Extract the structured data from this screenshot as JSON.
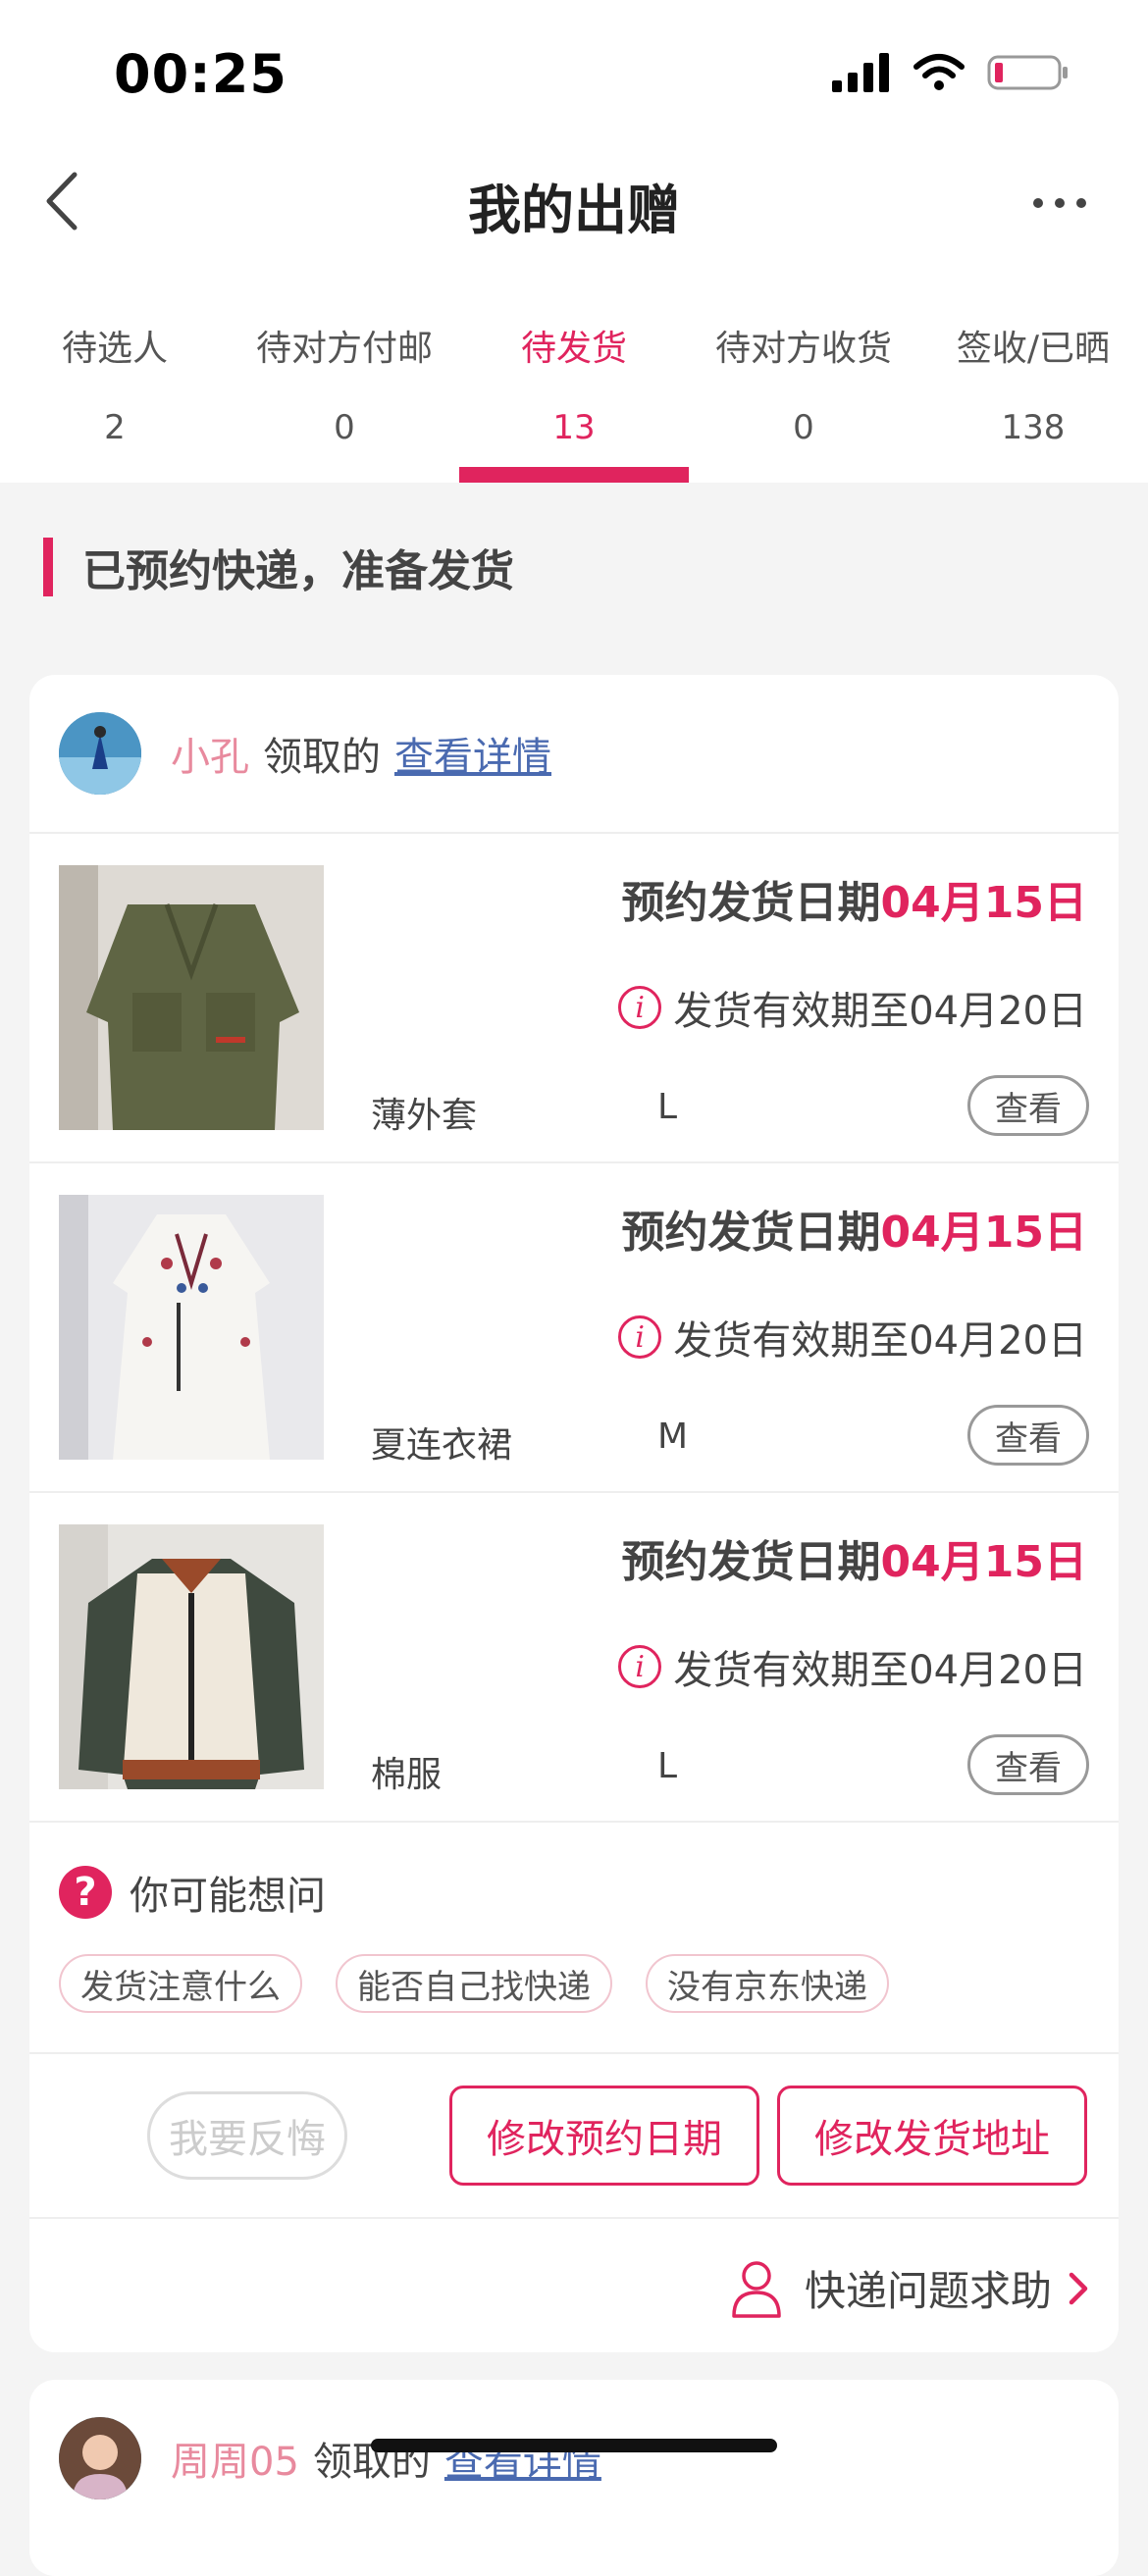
{
  "status_bar": {
    "time": "00:25"
  },
  "nav": {
    "title": "我的出赠",
    "back_icon": "chevron-left-icon",
    "more_icon": "more-icon"
  },
  "tabs": [
    {
      "label": "待选人",
      "count": "2"
    },
    {
      "label": "待对方付邮",
      "count": "0"
    },
    {
      "label": "待发货",
      "count": "13",
      "active": true
    },
    {
      "label": "待对方收货",
      "count": "0"
    },
    {
      "label": "签收/已晒",
      "count": "138"
    }
  ],
  "section": {
    "title": "已预约快递，准备发货"
  },
  "cards": [
    {
      "recipient": "小孔",
      "claimed_text": "领取的",
      "detail_link": "查看详情",
      "items": [
        {
          "name": "薄外套",
          "size": "L",
          "ship_label": "预约发货日期",
          "ship_date": "04月15日",
          "valid_text": "发货有效期至04月20日",
          "view_label": "查看"
        },
        {
          "name": "夏连衣裙",
          "size": "M",
          "ship_label": "预约发货日期",
          "ship_date": "04月15日",
          "valid_text": "发货有效期至04月20日",
          "view_label": "查看"
        },
        {
          "name": "棉服",
          "size": "L",
          "ship_label": "预约发货日期",
          "ship_date": "04月15日",
          "valid_text": "发货有效期至04月20日",
          "view_label": "查看"
        }
      ],
      "faq": {
        "title": "你可能想问",
        "chips": [
          "发货注意什么",
          "能否自己找快递",
          "没有京东快递"
        ]
      },
      "actions": {
        "regret": "我要反悔",
        "modify_date": "修改预约日期",
        "modify_address": "修改发货地址"
      },
      "help": {
        "label": "快递问题求助"
      }
    },
    {
      "recipient": "周周05",
      "claimed_text": "领取的",
      "detail_link": "查看详情"
    }
  ],
  "colors": {
    "accent": "#e0245e",
    "link": "#4a6ab0",
    "background": "#f4f4f4"
  }
}
